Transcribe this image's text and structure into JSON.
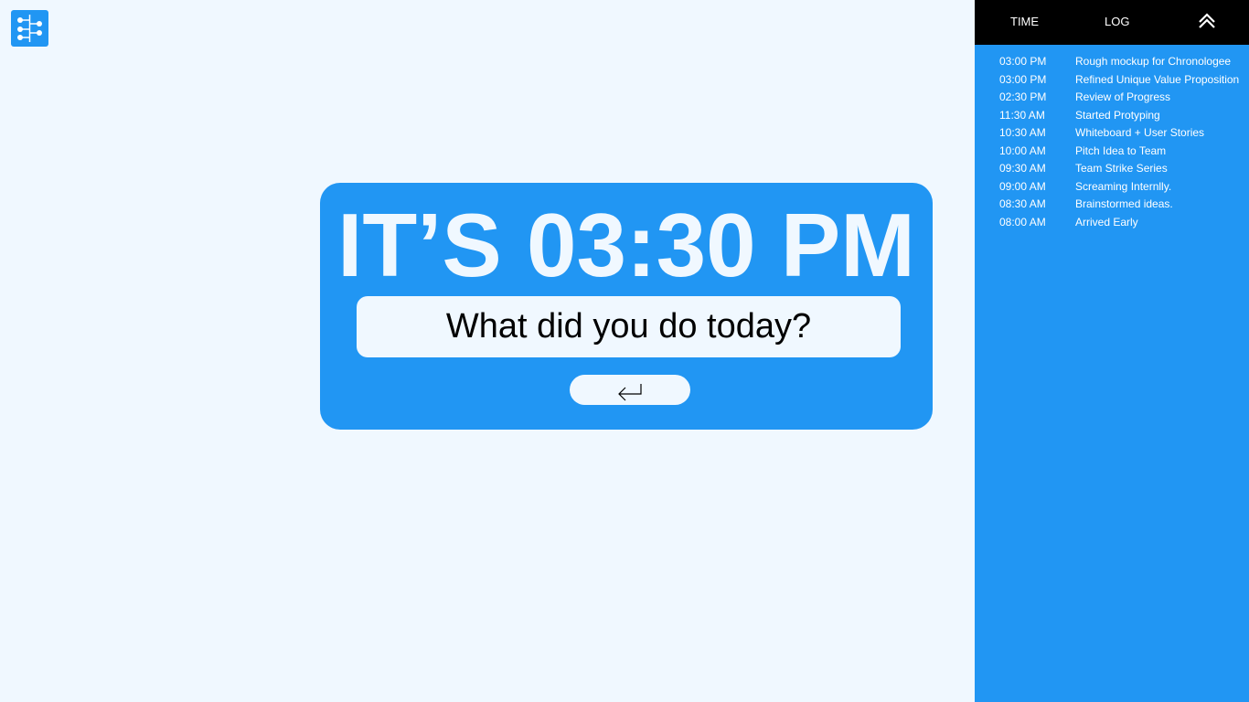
{
  "clock": {
    "text": "IT’S 03:30 PM"
  },
  "prompt": {
    "placeholder": "What did you do today?",
    "value": ""
  },
  "submit": {
    "icon": "enter-arrow-icon"
  },
  "logo": {
    "icon": "timeline-logo-icon"
  },
  "sidebar": {
    "headers": {
      "time": "TIME",
      "log": "LOG"
    },
    "collapse_icon": "double-chevron-up-icon",
    "entries": [
      {
        "time": "03:00 PM",
        "text": "Rough mockup for Chronologee"
      },
      {
        "time": "03:00 PM",
        "text": "Refined Unique Value Proposition"
      },
      {
        "time": "02:30 PM",
        "text": "Review of Progress"
      },
      {
        "time": "11:30 AM",
        "text": "Started Protyping"
      },
      {
        "time": "10:30 AM",
        "text": "Whiteboard + User Stories"
      },
      {
        "time": "10:00 AM",
        "text": "Pitch Idea to Team"
      },
      {
        "time": "09:30 AM",
        "text": "Team Strike Series"
      },
      {
        "time": "09:00 AM",
        "text": "Screaming Internlly."
      },
      {
        "time": "08:30 AM",
        "text": "Brainstormed ideas."
      },
      {
        "time": "08:00 AM",
        "text": "Arrived Early"
      }
    ]
  },
  "colors": {
    "accent": "#2196f3",
    "background": "#f0f8ff",
    "header": "#000000",
    "text_light": "#ffffff"
  }
}
